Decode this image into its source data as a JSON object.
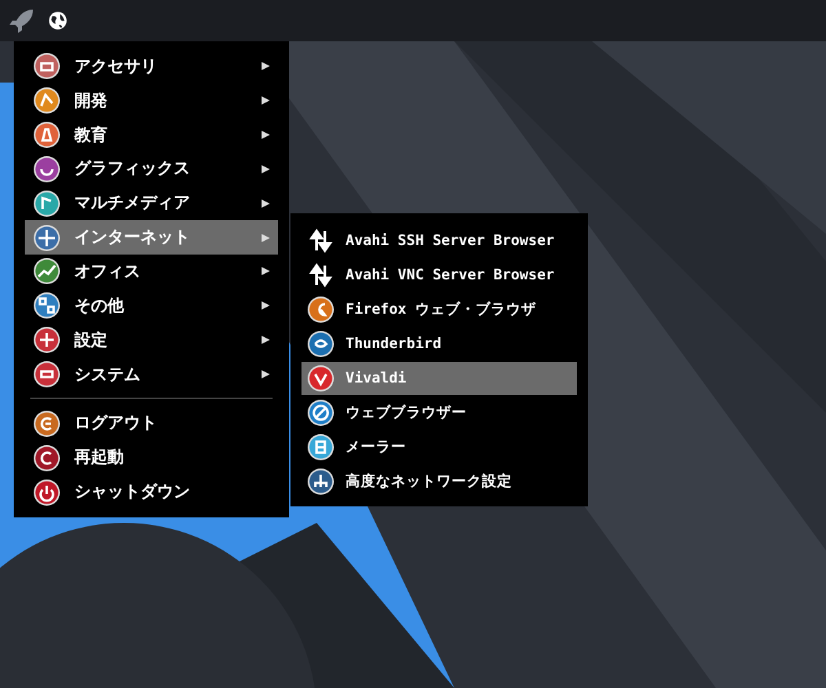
{
  "main_menu": {
    "items": [
      {
        "label": "アクセサリ",
        "has_submenu": true,
        "selected": false,
        "color": "#c0615f"
      },
      {
        "label": "開発",
        "has_submenu": true,
        "selected": false,
        "color": "#e08a1e"
      },
      {
        "label": "教育",
        "has_submenu": true,
        "selected": false,
        "color": "#e0623a"
      },
      {
        "label": "グラフィックス",
        "has_submenu": true,
        "selected": false,
        "color": "#9b3fa0"
      },
      {
        "label": "マルチメディア",
        "has_submenu": true,
        "selected": false,
        "color": "#2aa8a8"
      },
      {
        "label": "インターネット",
        "has_submenu": true,
        "selected": true,
        "color": "#3c6ea8"
      },
      {
        "label": "オフィス",
        "has_submenu": true,
        "selected": false,
        "color": "#3f8a3a"
      },
      {
        "label": "その他",
        "has_submenu": true,
        "selected": false,
        "color": "#2f7fbf"
      },
      {
        "label": "設定",
        "has_submenu": true,
        "selected": false,
        "color": "#c8303a"
      },
      {
        "label": "システム",
        "has_submenu": true,
        "selected": false,
        "color": "#c8303a"
      }
    ],
    "session_items": [
      {
        "label": "ログアウト",
        "selected": false,
        "color": "#c86a20"
      },
      {
        "label": "再起動",
        "selected": false,
        "color": "#a01828"
      },
      {
        "label": "シャットダウン",
        "selected": false,
        "color": "#c01828"
      }
    ]
  },
  "submenu": {
    "items": [
      {
        "label": "Avahi SSH Server Browser",
        "kind": "transfer",
        "selected": false
      },
      {
        "label": "Avahi VNC Server Browser",
        "kind": "transfer",
        "selected": false
      },
      {
        "label": "Firefox ウェブ・ブラウザ",
        "kind": "app",
        "color": "#d8701a",
        "selected": false
      },
      {
        "label": "Thunderbird",
        "kind": "app",
        "color": "#1c6fb0",
        "selected": false
      },
      {
        "label": "Vivaldi",
        "kind": "app",
        "color": "#d8282c",
        "selected": true
      },
      {
        "label": "ウェブブラウザー",
        "kind": "app",
        "color": "#1f7fc8",
        "selected": false
      },
      {
        "label": "メーラー",
        "kind": "app",
        "color": "#38a8d8",
        "selected": false
      },
      {
        "label": "高度なネットワーク設定",
        "kind": "app",
        "color": "#2c5c8c",
        "selected": false
      }
    ]
  }
}
